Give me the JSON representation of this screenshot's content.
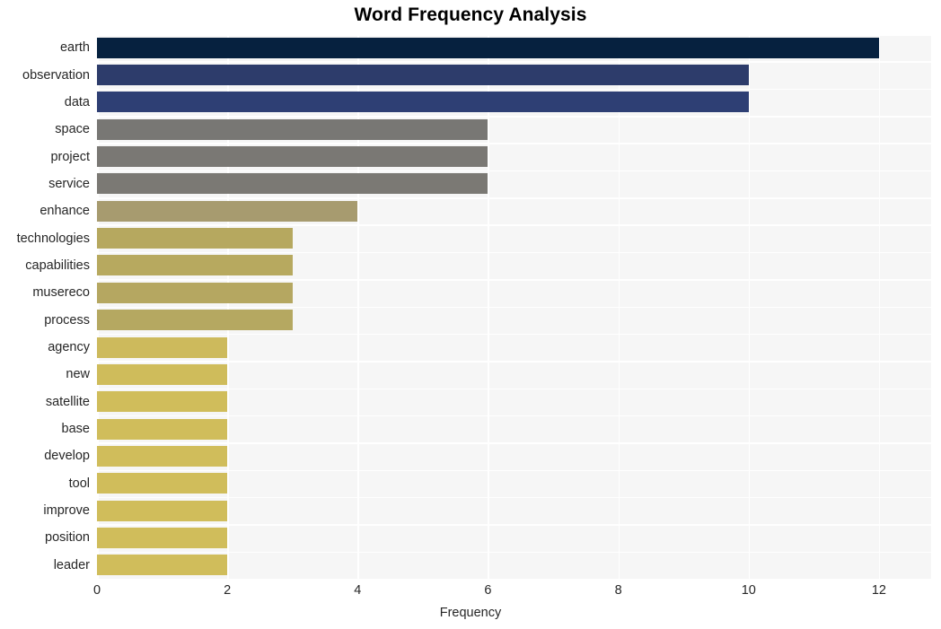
{
  "chart_data": {
    "type": "bar",
    "orientation": "horizontal",
    "title": "Word Frequency Analysis",
    "xlabel": "Frequency",
    "ylabel": "",
    "xlim": [
      0,
      12.8
    ],
    "ylim": null,
    "grid": true,
    "legend": null,
    "x_ticks": [
      0,
      2,
      4,
      6,
      8,
      10,
      12
    ],
    "x_tick_labels": [
      "0",
      "2",
      "4",
      "6",
      "8",
      "10",
      "12"
    ],
    "categories": [
      "earth",
      "observation",
      "data",
      "space",
      "project",
      "service",
      "enhance",
      "technologies",
      "capabilities",
      "musereco",
      "process",
      "agency",
      "new",
      "satellite",
      "base",
      "develop",
      "tool",
      "improve",
      "position",
      "leader"
    ],
    "values": [
      12,
      10,
      10,
      6,
      6,
      6,
      4,
      3,
      3,
      3,
      3,
      2,
      2,
      2,
      2,
      2,
      2,
      2,
      2,
      2
    ],
    "bar_colors": [
      "#06213f",
      "#2d3c6b",
      "#2e3f74",
      "#787774",
      "#7a7874",
      "#7b7974",
      "#a79b6f",
      "#b6a85f",
      "#b7a95f",
      "#b5a761",
      "#b5a861",
      "#cdba5c",
      "#cfbc5b",
      "#d0bd5b",
      "#d0bd5b",
      "#d0bd5b",
      "#d0bd5b",
      "#d0bd5b",
      "#d0bd5b",
      "#d0bd5b"
    ],
    "plot_background": "#f6f6f6",
    "gridline_color": "#ffffff",
    "figure_background": "#ffffff"
  }
}
